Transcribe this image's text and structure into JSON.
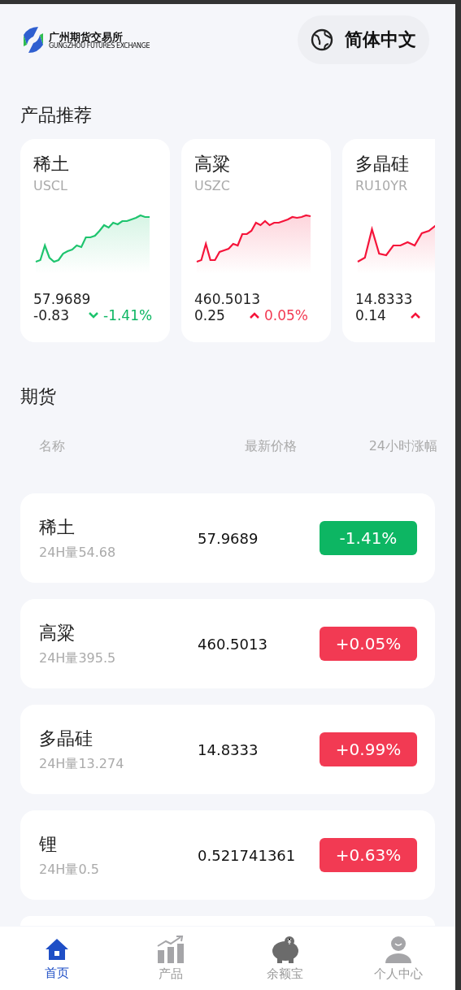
{
  "header": {
    "logo": {
      "name": "广州期货交易所",
      "subtitle": "GUNGZHOU FUTURES EXCHANGE"
    },
    "language": "简体中文"
  },
  "recommend": {
    "title": "产品推荐",
    "cards": [
      {
        "name": "稀土",
        "code": "USCL",
        "price": "57.9689",
        "change": "-0.83",
        "change_pct": "-1.41%",
        "rising": false
      },
      {
        "name": "高粱",
        "code": "USZC",
        "price": "460.5013",
        "change": "0.25",
        "change_pct": "0.05%",
        "rising": true
      },
      {
        "name": "多晶硅",
        "code": "RU10YR",
        "price": "14.8333",
        "change": "0.14",
        "rising": true
      }
    ]
  },
  "futures": {
    "title": "期货",
    "columns": [
      "名称",
      "最新价格",
      "24小时涨幅"
    ],
    "rows": [
      {
        "name": "稀土",
        "volume": "24H量54.68",
        "price": "57.9689",
        "change": "-1.41%",
        "rising": false
      },
      {
        "name": "高粱",
        "volume": "24H量395.5",
        "price": "460.5013",
        "change": "+0.05%",
        "rising": true
      },
      {
        "name": "多晶硅",
        "volume": "24H量13.274",
        "price": "14.8333",
        "change": "+0.99%",
        "rising": true
      },
      {
        "name": "锂",
        "volume": "24H量0.5",
        "price": "0.521741361",
        "change": "+0.63%",
        "rising": true
      }
    ]
  },
  "nav": [
    {
      "label": "首页",
      "kind": "home",
      "selected": true
    },
    {
      "label": "产品",
      "kind": "chart",
      "selected": false
    },
    {
      "label": "余额宝",
      "kind": "piggy",
      "selected": false
    },
    {
      "label": "个人中心",
      "kind": "user",
      "selected": false
    }
  ]
}
